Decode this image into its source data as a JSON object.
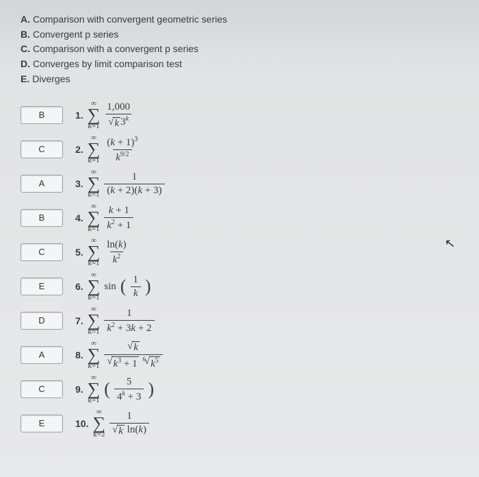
{
  "options": [
    {
      "letter": "A.",
      "text": "Comparison with convergent geometric series"
    },
    {
      "letter": "B.",
      "text": "Convergent p series"
    },
    {
      "letter": "C.",
      "text": "Comparison with a convergent p series"
    },
    {
      "letter": "D.",
      "text": "Converges by limit comparison test"
    },
    {
      "letter": "E.",
      "text": "Diverges"
    }
  ],
  "problems": [
    {
      "n": "1.",
      "ans": "B",
      "lo": "k=1",
      "hi": "∞",
      "num": "1,000",
      "den": "√k 3ᵏ"
    },
    {
      "n": "2.",
      "ans": "C",
      "lo": "k=1",
      "hi": "∞",
      "num": "(k + 1)³",
      "den": "k⁹ᐟ²"
    },
    {
      "n": "3.",
      "ans": "A",
      "lo": "k=1",
      "hi": "∞",
      "num": "1",
      "den": "(k + 2)(k + 3)"
    },
    {
      "n": "4.",
      "ans": "B",
      "lo": "k=1",
      "hi": "∞",
      "num": "k + 1",
      "den": "k² + 1"
    },
    {
      "n": "5.",
      "ans": "C",
      "lo": "k=1",
      "hi": "∞",
      "num": "ln(k)",
      "den": "k²"
    },
    {
      "n": "6.",
      "ans": "E",
      "lo": "k=1",
      "hi": "∞",
      "fn": "sin",
      "pnum": "1",
      "pden": "k"
    },
    {
      "n": "7.",
      "ans": "D",
      "lo": "k=1",
      "hi": "∞",
      "num": "1",
      "den": "k² + 3k + 2"
    },
    {
      "n": "8.",
      "ans": "A",
      "lo": "k=1",
      "hi": "∞",
      "num": "√k",
      "den": "√k³ + 1 ⁶√k⁵"
    },
    {
      "n": "9.",
      "ans": "C",
      "lo": "k=1",
      "hi": "∞",
      "pnum": "5",
      "pden": "4ᵏ + 3"
    },
    {
      "n": "10.",
      "ans": "E",
      "lo": "k=2",
      "hi": "∞",
      "num": "1",
      "den": "√k ln(k)"
    }
  ]
}
